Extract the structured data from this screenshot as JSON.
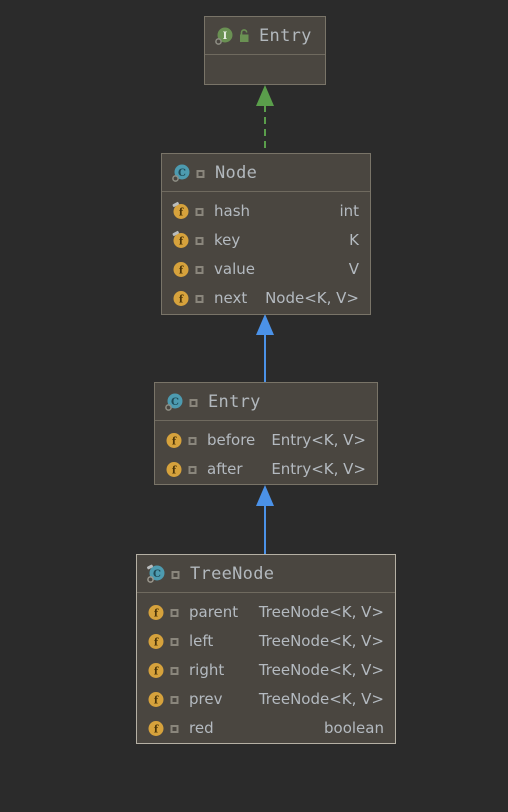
{
  "diagram": {
    "type": "uml-class-diagram",
    "background_color": "#2b2b2b",
    "box_fill_color": "#4a4640",
    "box_border_color": "#797468",
    "selected_border_color": "#b5b0a4",
    "text_color": "#b4bac0",
    "title_color": "#b2b8bd"
  },
  "nodes": [
    {
      "id": "entry-interface",
      "name": "Entry",
      "stereotype": "interface",
      "kind_icon": "interface-icon",
      "kind_icon_letter": "I",
      "kind_icon_color": "#6a9153",
      "modifier_icon": "lock-icon",
      "modifier_icon_color": "#6a9153",
      "visibility_icon": null,
      "selected": false,
      "fields": []
    },
    {
      "id": "node-class",
      "name": "Node",
      "stereotype": "class",
      "kind_icon": "class-icon",
      "kind_icon_letter": "C",
      "kind_icon_color": "#4d9bb0",
      "modifier_icon": null,
      "visibility_icon": "package-private-icon",
      "selected": false,
      "fields": [
        {
          "icon": "field-icon",
          "final": true,
          "visibility_icon": "package-private-icon",
          "name": "hash",
          "type": "int"
        },
        {
          "icon": "field-icon",
          "final": true,
          "visibility_icon": "package-private-icon",
          "name": "key",
          "type": "K"
        },
        {
          "icon": "field-icon",
          "final": false,
          "visibility_icon": "package-private-icon",
          "name": "value",
          "type": "V"
        },
        {
          "icon": "field-icon",
          "final": false,
          "visibility_icon": "package-private-icon",
          "name": "next",
          "type": "Node<K, V>"
        }
      ]
    },
    {
      "id": "entry-class",
      "name": "Entry",
      "stereotype": "class",
      "kind_icon": "class-icon",
      "kind_icon_letter": "C",
      "kind_icon_color": "#4d9bb0",
      "modifier_icon": null,
      "visibility_icon": "package-private-icon",
      "selected": false,
      "fields": [
        {
          "icon": "field-icon",
          "final": false,
          "visibility_icon": "package-private-icon",
          "name": "before",
          "type": "Entry<K, V>"
        },
        {
          "icon": "field-icon",
          "final": false,
          "visibility_icon": "package-private-icon",
          "name": "after",
          "type": "Entry<K, V>"
        }
      ]
    },
    {
      "id": "treenode-class",
      "name": "TreeNode",
      "stereotype": "class",
      "kind_icon": "class-icon",
      "kind_icon_letter": "C",
      "kind_icon_color": "#4d9bb0",
      "modifier_icon": null,
      "visibility_icon": "package-private-icon",
      "selected": true,
      "fields": [
        {
          "icon": "field-icon",
          "final": false,
          "visibility_icon": "package-private-icon",
          "name": "parent",
          "type": "TreeNode<K, V>"
        },
        {
          "icon": "field-icon",
          "final": false,
          "visibility_icon": "package-private-icon",
          "name": "left",
          "type": "TreeNode<K, V>"
        },
        {
          "icon": "field-icon",
          "final": false,
          "visibility_icon": "package-private-icon",
          "name": "right",
          "type": "TreeNode<K, V>"
        },
        {
          "icon": "field-icon",
          "final": false,
          "visibility_icon": "package-private-icon",
          "name": "prev",
          "type": "TreeNode<K, V>"
        },
        {
          "icon": "field-icon",
          "final": false,
          "visibility_icon": "package-private-icon",
          "name": "red",
          "type": "boolean"
        }
      ]
    }
  ],
  "edges": [
    {
      "id": "edge-node-implements-entry",
      "from": "node-class",
      "to": "entry-interface",
      "relation": "realization",
      "line_style": "dashed",
      "color": "#5a9e4b",
      "arrow": "filled-triangle"
    },
    {
      "id": "edge-entryclass-extends-node",
      "from": "entry-class",
      "to": "node-class",
      "relation": "generalization",
      "line_style": "solid",
      "color": "#4b92e8",
      "arrow": "filled-triangle"
    },
    {
      "id": "edge-treenode-extends-entryclass",
      "from": "treenode-class",
      "to": "entry-class",
      "relation": "generalization",
      "line_style": "solid",
      "color": "#4b92e8",
      "arrow": "filled-triangle"
    }
  ]
}
